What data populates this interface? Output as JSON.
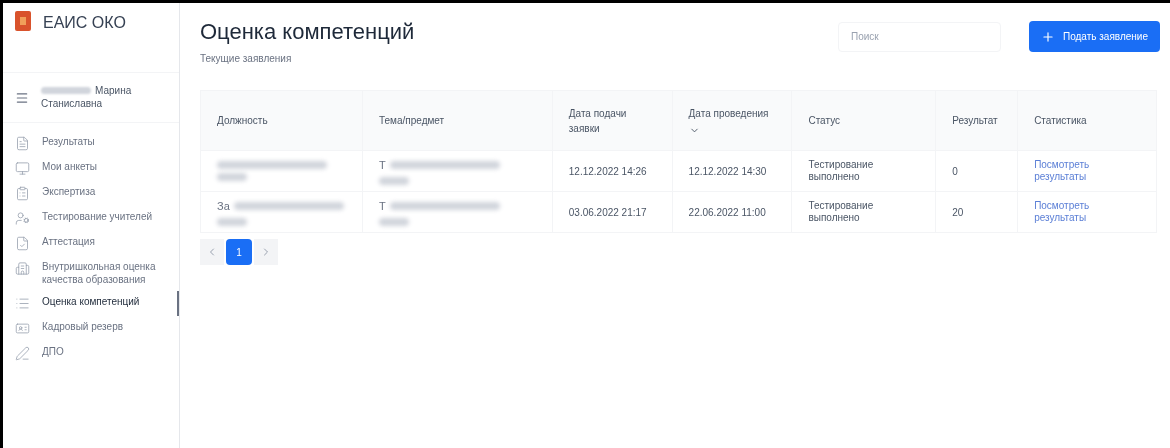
{
  "app": {
    "name": "ЕАИС ОКО"
  },
  "user": {
    "name": "Марина",
    "patronymic": "Станиславна",
    "surname_redacted": true
  },
  "sidebar": {
    "items": [
      {
        "label": "Результаты",
        "selected": false
      },
      {
        "label": "Мои анкеты",
        "selected": false
      },
      {
        "label": "Экспертиза",
        "selected": false
      },
      {
        "label": "Тестирование учителей",
        "selected": false
      },
      {
        "label": "Аттестация",
        "selected": false
      },
      {
        "label": "Внутришкольная оценка качества образования",
        "selected": false
      },
      {
        "label": "Оценка компетенций",
        "selected": true
      },
      {
        "label": "Кадровый резерв",
        "selected": false
      },
      {
        "label": "ДПО",
        "selected": false
      }
    ]
  },
  "page": {
    "title": "Оценка компетенций",
    "subtitle": "Текущие заявления"
  },
  "search": {
    "placeholder": "Поиск"
  },
  "add_button": {
    "label": "Подать заявление"
  },
  "table": {
    "columns": [
      {
        "label": "Должность"
      },
      {
        "label": "Тема/предмет"
      },
      {
        "label": "Дата подачи заявки"
      },
      {
        "label": "Дата проведения",
        "sorted": true
      },
      {
        "label": "Статус"
      },
      {
        "label": "Результат"
      },
      {
        "label": "Статистика"
      }
    ],
    "rows": [
      {
        "position": {
          "redacted": true
        },
        "subject": {
          "text": "Т",
          "redacted": true
        },
        "submitted": "12.12.2022 14:26",
        "held": "12.12.2022 14:30",
        "status": "Тестирование выполнено",
        "result": "0",
        "link": "Посмотреть результаты"
      },
      {
        "position": {
          "text": "За",
          "redacted": true
        },
        "subject": {
          "text": "Т",
          "redacted": true
        },
        "submitted": "03.06.2022 21:17",
        "held": "22.06.2022 11:00",
        "status": "Тестирование выполнено",
        "result": "20",
        "link": "Посмотреть результаты"
      }
    ]
  },
  "pagination": {
    "pages": [
      {
        "label": "1",
        "selected": true
      }
    ]
  }
}
